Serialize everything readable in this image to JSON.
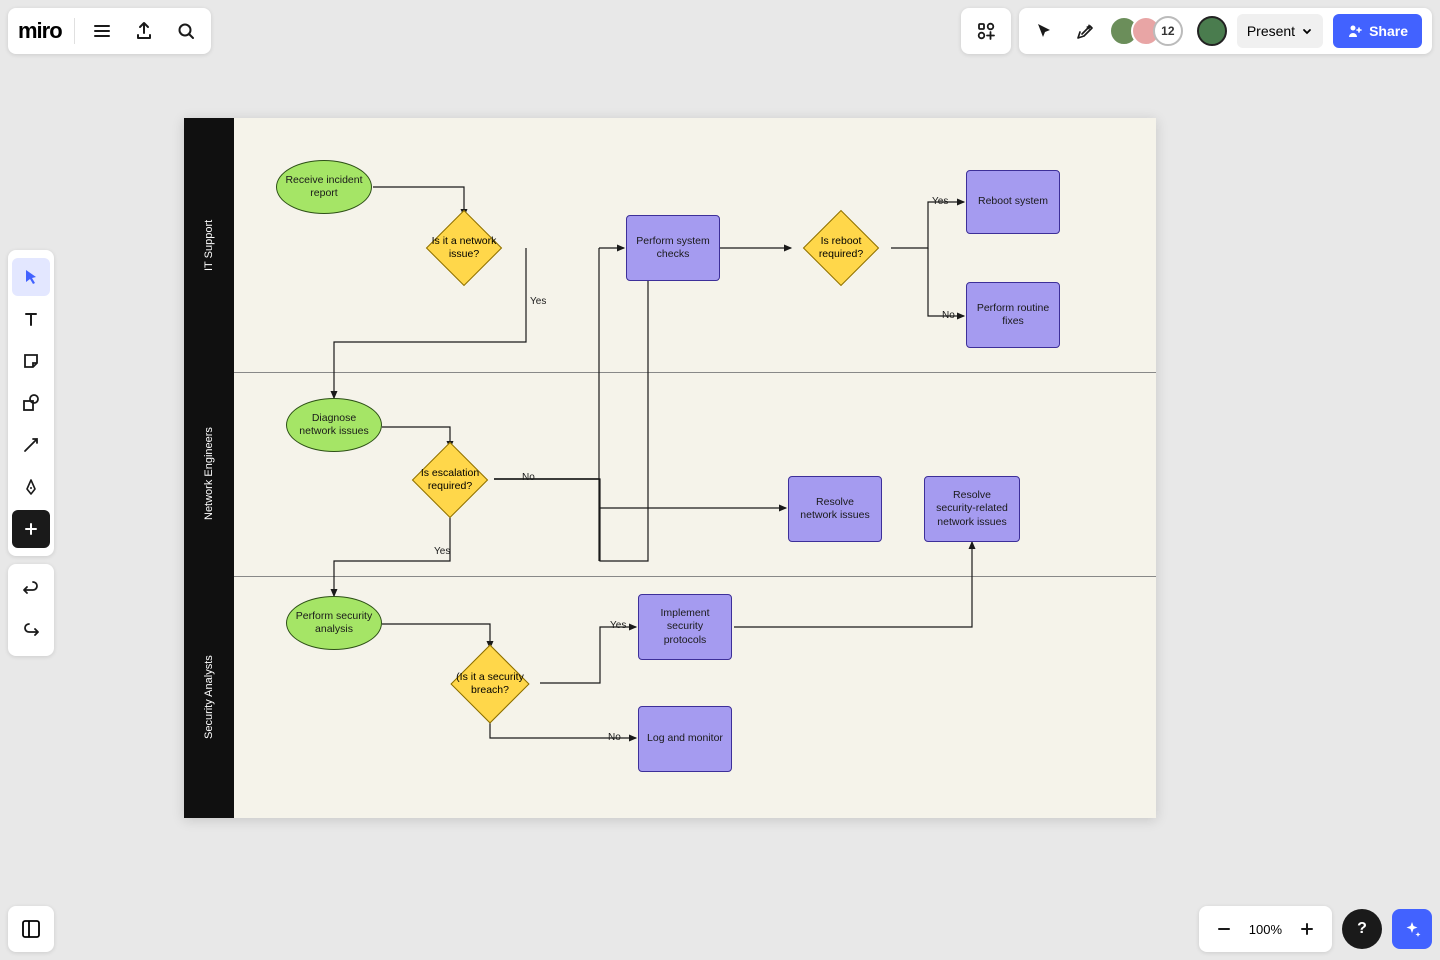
{
  "app": {
    "logo": "miro"
  },
  "topbar": {
    "collaborator_overflow": "12",
    "present_label": "Present",
    "share_label": "Share"
  },
  "zoom": {
    "level": "100%"
  },
  "lanes": [
    {
      "name": "IT Support"
    },
    {
      "name": "Network Engineers"
    },
    {
      "name": "Security Analysts"
    }
  ],
  "nodes": {
    "receive_incident": "Receive incident report",
    "is_network": "Is it a network issue?",
    "perform_checks": "Perform system checks",
    "is_reboot": "Is reboot required?",
    "reboot_system": "Reboot system",
    "routine_fixes": "Perform routine fixes",
    "diagnose_network": "Diagnose network issues",
    "is_escalation": "Is escalation required?",
    "resolve_network": "Resolve network issues",
    "resolve_sec_network": "Resolve security-related network issues",
    "security_analysis": "Perform security analysis",
    "is_breach": "(Is it a security breach?",
    "implement_protocols": "Implement security protocols",
    "log_monitor": "Log and monitor"
  },
  "edge_labels": {
    "yes": "Yes",
    "no": "No"
  },
  "avatars": {
    "a1_bg": "#6b8e5a",
    "a2_bg": "#e8a5a5",
    "a4_bg": "#4a7c4e"
  }
}
